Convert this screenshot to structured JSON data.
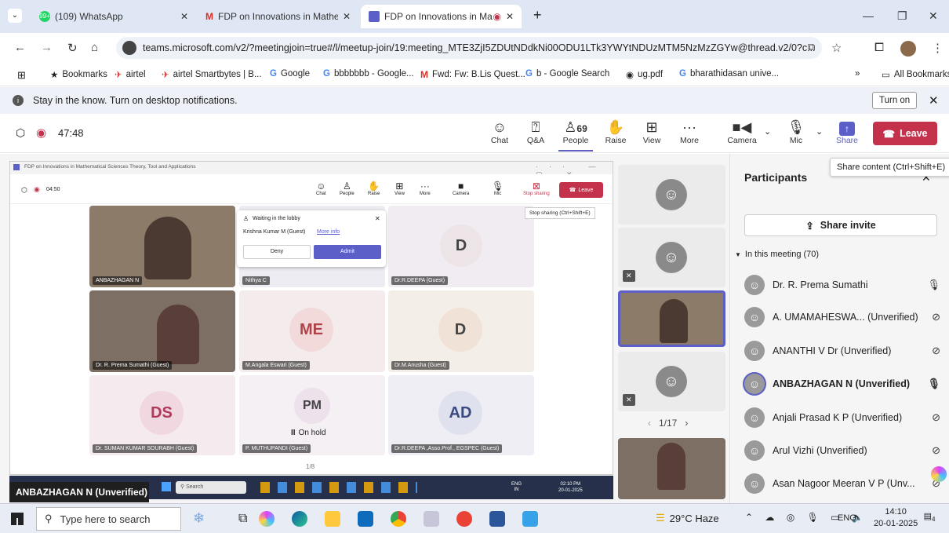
{
  "tabs": [
    {
      "title": "(109) WhatsApp",
      "badge": "99+"
    },
    {
      "title": "FDP on Innovations in Mathema"
    },
    {
      "title": "FDP on Innovations in Math"
    }
  ],
  "new_tab": "+",
  "url": "teams.microsoft.com/v2/?meetingjoin=true#/l/meetup-join/19:meeting_MTE3ZjI5ZDUtNDdkNi00ODU1LTk3YWYtNDUzMTM5NzMzZGYw@thread.v2/0?c...",
  "bookmarks": [
    "Bookmarks",
    "airtel",
    "airtel Smartbytes | B...",
    "Google",
    "bbbbbbb - Google...",
    "Fwd: Fw: B.Lis Quest...",
    "b - Google Search",
    "ug.pdf",
    "bharathidasan unive..."
  ],
  "bookmarks_more": "»",
  "all_bookmarks": "All Bookmarks",
  "notification": {
    "text": "Stay in the know. Turn on desktop notifications.",
    "button": "Turn on"
  },
  "meeting": {
    "timer": "47:48",
    "toolbar": {
      "chat": "Chat",
      "qa": "Q&A",
      "people": "People",
      "people_count": "69",
      "raise": "Raise",
      "view": "View",
      "more": "More",
      "camera": "Camera",
      "mic": "Mic",
      "share": "Share",
      "leave": "Leave"
    },
    "share_tooltip": "Share content (Ctrl+Shift+E)"
  },
  "inner": {
    "title": "FDP on Innovations in Mathematical Sciences Theory, Tool and Applications",
    "timer": "04:50",
    "toolbar": {
      "chat": "Chat",
      "people": "People",
      "raise": "Raise",
      "view": "View",
      "more": "More",
      "camera": "Camera",
      "mic": "Mic",
      "stop": "Stop sharing",
      "leave": "Leave"
    },
    "stop_tooltip": "Stop sharing (Ctrl+Shift+E)",
    "lobby": {
      "title": "Waiting in the lobby",
      "person": "Krishna Kumar M (Guest)",
      "more": "More info",
      "deny": "Deny",
      "admit": "Admit"
    },
    "tiles": [
      {
        "label": "ANBAZHAGAN N"
      },
      {
        "label": "Nithya C"
      },
      {
        "initials": "D",
        "label": "Dr.R.DEEPA (Guest)"
      },
      {
        "label": "Dr. R. Prema Sumathi (Guest)"
      },
      {
        "initials": "ME",
        "label": "M.Angala Eswari (Guest)"
      },
      {
        "initials": "D",
        "label": "Dr.M.Anusha (Guest)"
      },
      {
        "initials": "DS",
        "label": "Dr. SUMAN KUMAR SOURABH (Guest)"
      },
      {
        "initials": "PM",
        "label": "P. MUTHUPANDI (Guest)",
        "status": "On hold"
      },
      {
        "initials": "AD",
        "label": "Dr.R.DEEPA ,Asso.Prof., EGSPEC (Guest)"
      }
    ],
    "page": "1/8",
    "taskbar_search": "Search",
    "taskbar_lang": "ENG",
    "taskbar_region": "IN",
    "taskbar_time": "02:10 PM",
    "taskbar_date": "20-01-2025"
  },
  "speaker_label": "ANBAZHAGAN N (Unverified)",
  "right_page": "1/17",
  "participants": {
    "title": "Participants",
    "share_invite": "Share invite",
    "section": "In this meeting (70)",
    "list": [
      {
        "name": "Dr. R. Prema Sumathi",
        "mic": "on"
      },
      {
        "name": "A. UMAMAHESWA... (Unverified)",
        "mic": "muted"
      },
      {
        "name": "ANANTHI V Dr (Unverified)",
        "mic": "muted"
      },
      {
        "name": "ANBAZHAGAN N (Unverified)",
        "mic": "on"
      },
      {
        "name": "Anjali Prasad K P (Unverified)",
        "mic": "muted"
      },
      {
        "name": "Arul Vizhi (Unverified)",
        "mic": "muted"
      },
      {
        "name": "Asan Nagoor Meeran V P (Unv...",
        "mic": "muted"
      }
    ]
  },
  "taskbar": {
    "search": "Type here to search",
    "weather": "29°C  Haze",
    "lang": "ENG",
    "time": "14:10",
    "date": "20-01-2025",
    "notif_count": "4"
  }
}
